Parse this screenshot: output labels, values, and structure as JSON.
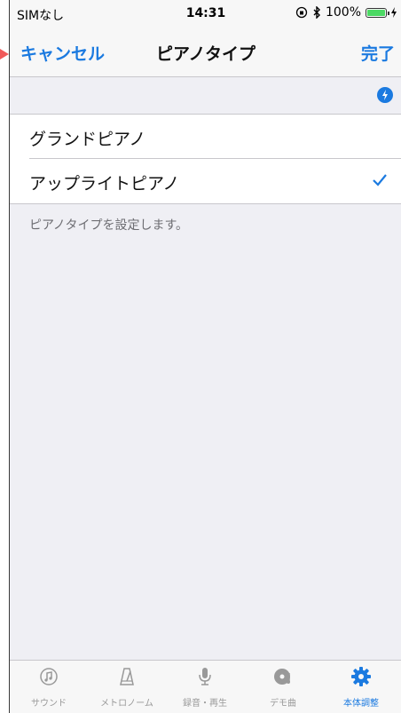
{
  "status_bar": {
    "carrier": "SIMなし",
    "time": "14:31",
    "battery": "100%"
  },
  "nav": {
    "cancel": "キャンセル",
    "title": "ピアノタイプ",
    "done": "完了"
  },
  "list": {
    "items": [
      {
        "label": "グランドピアノ",
        "selected": false
      },
      {
        "label": "アップライトピアノ",
        "selected": true
      }
    ],
    "footnote": "ピアノタイプを設定します。"
  },
  "tabs": [
    {
      "label": "サウンド",
      "icon": "sound-icon"
    },
    {
      "label": "メトロノーム",
      "icon": "metronome-icon"
    },
    {
      "label": "録音・再生",
      "icon": "microphone-icon"
    },
    {
      "label": "デモ曲",
      "icon": "demo-disc-icon"
    },
    {
      "label": "本体調整",
      "icon": "gear-icon",
      "active": true
    }
  ],
  "colors": {
    "accent": "#1b7ae0",
    "background": "#efeff4",
    "battery": "#4cd964"
  }
}
